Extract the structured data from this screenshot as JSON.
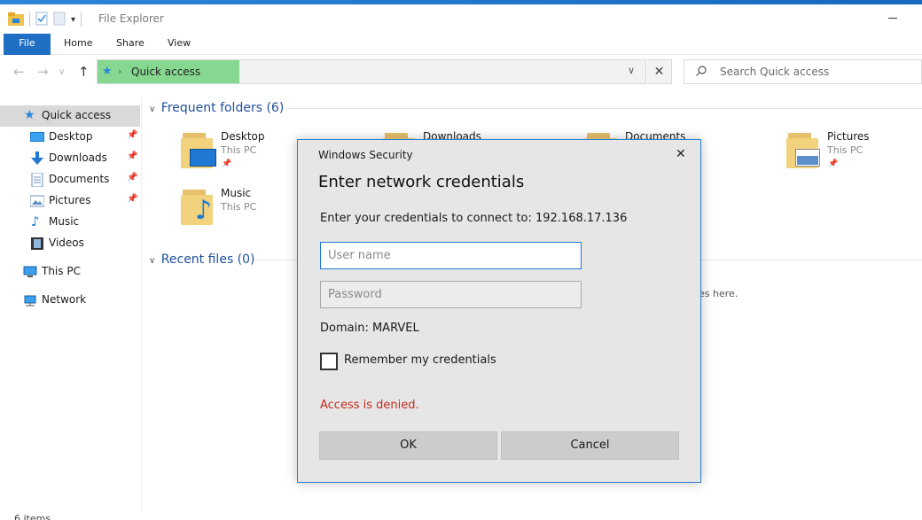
{
  "window": {
    "title": "File Explorer"
  },
  "ribbon": {
    "tabs": [
      "File",
      "Home",
      "Share",
      "View"
    ]
  },
  "address": {
    "location": "Quick access"
  },
  "search": {
    "placeholder": "Search Quick access"
  },
  "sidebar": {
    "items": [
      {
        "label": "Quick access",
        "icon": "star-icon",
        "active": true
      },
      {
        "label": "Desktop",
        "icon": "desktop-icon",
        "pinned": true
      },
      {
        "label": "Downloads",
        "icon": "download-icon",
        "pinned": true
      },
      {
        "label": "Documents",
        "icon": "document-icon",
        "pinned": true
      },
      {
        "label": "Pictures",
        "icon": "picture-icon",
        "pinned": true
      },
      {
        "label": "Music",
        "icon": "music-icon"
      },
      {
        "label": "Videos",
        "icon": "video-icon"
      },
      {
        "label": "This PC",
        "icon": "computer-icon"
      },
      {
        "label": "Network",
        "icon": "network-icon"
      }
    ]
  },
  "main": {
    "frequent_header": "Frequent folders (6)",
    "recent_header": "Recent files (0)",
    "recent_hint": "es here.",
    "folders": [
      {
        "name": "Desktop",
        "location": "This PC"
      },
      {
        "name": "Downloads",
        "location": ""
      },
      {
        "name": "Documents",
        "location": ""
      },
      {
        "name": "Pictures",
        "location": "This PC"
      },
      {
        "name": "Music",
        "location": "This PC"
      }
    ]
  },
  "status": {
    "item_count": "6 items"
  },
  "dialog": {
    "caption": "Windows Security",
    "title": "Enter network credentials",
    "prompt": "Enter your credentials to connect to: 192.168.17.136",
    "username_placeholder": "User name",
    "password_placeholder": "Password",
    "domain": "Domain: MARVEL",
    "remember_label": "Remember my credentials",
    "remember_checked": false,
    "error": "Access is denied.",
    "ok_label": "OK",
    "cancel_label": "Cancel"
  },
  "colors": {
    "accent": "#1e6fc4",
    "address_highlight": "#86d78f",
    "error": "#c42b1c",
    "dialog_border": "#2b7fcf"
  }
}
